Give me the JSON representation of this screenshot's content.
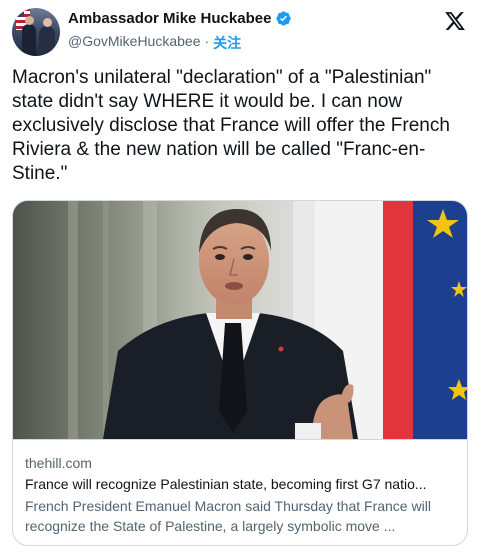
{
  "author": {
    "display_name": "Ambassador Mike Huckabee",
    "handle": "@GovMikeHuckabee",
    "separator": "·",
    "follow_label": "关注"
  },
  "tweet": {
    "text": "Macron's unilateral \"declaration\" of a \"Palestinian\" state didn't say WHERE it would be. I can now exclusively disclose that France will offer the French Riviera & the new nation will be called \"Franc-en-Stine.\""
  },
  "link_card": {
    "domain": "thehill.com",
    "title": "France will recognize Palestinian state, becoming first G7 natio...",
    "description": "French President Emanuel Macron said Thursday that France will recognize the State of Palestine, a largely symbolic move ..."
  },
  "icons": {
    "verified": "verified-badge-icon",
    "platform": "x-logo-icon"
  },
  "colors": {
    "verified_blue": "#1d9bf0",
    "follow_blue": "#1d9bf0",
    "secondary_text": "#536471",
    "border": "#cfd9de"
  }
}
